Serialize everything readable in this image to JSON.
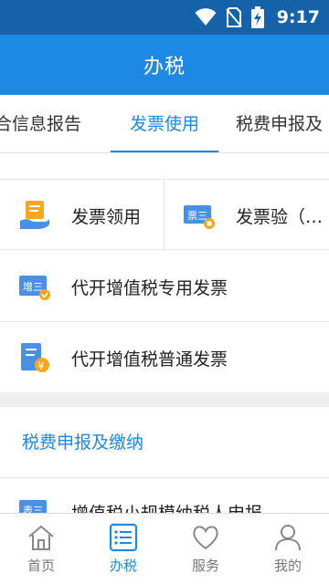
{
  "status_bar": {
    "time": "9:17",
    "icons": [
      "wifi-icon",
      "no-sim-icon",
      "battery-charging-icon"
    ]
  },
  "app_bar": {
    "title": "办税"
  },
  "tabs": [
    {
      "label": "合信息报告",
      "active": false
    },
    {
      "label": "发票使用",
      "active": true
    },
    {
      "label": "税费申报及",
      "active": false
    }
  ],
  "content": {
    "items_grid": [
      {
        "label": "发票领用",
        "icon": "invoice-collect-icon"
      },
      {
        "label": "发票验（…",
        "icon": "invoice-verify-icon"
      }
    ],
    "items_list": [
      {
        "label": "代开增值税专用发票",
        "icon": "special-vat-invoice-icon"
      },
      {
        "label": "代开增值税普通发票",
        "icon": "ordinary-vat-invoice-icon"
      }
    ],
    "section": {
      "title": "税费申报及缴纳"
    },
    "partial_item": {
      "label": "增值税小规模纳税人申报",
      "icon": "small-taxpayer-icon"
    }
  },
  "bottom_nav": [
    {
      "label": "首页",
      "icon": "home-icon",
      "active": false
    },
    {
      "label": "办税",
      "icon": "list-icon",
      "active": true
    },
    {
      "label": "服务",
      "icon": "heart-icon",
      "active": false
    },
    {
      "label": "我的",
      "icon": "person-icon",
      "active": false
    }
  ],
  "colors": {
    "primary": "#1e88e5",
    "status_bar": "#1562a8",
    "icon_orange": "#f5a623",
    "icon_blue": "#4a90e2"
  }
}
